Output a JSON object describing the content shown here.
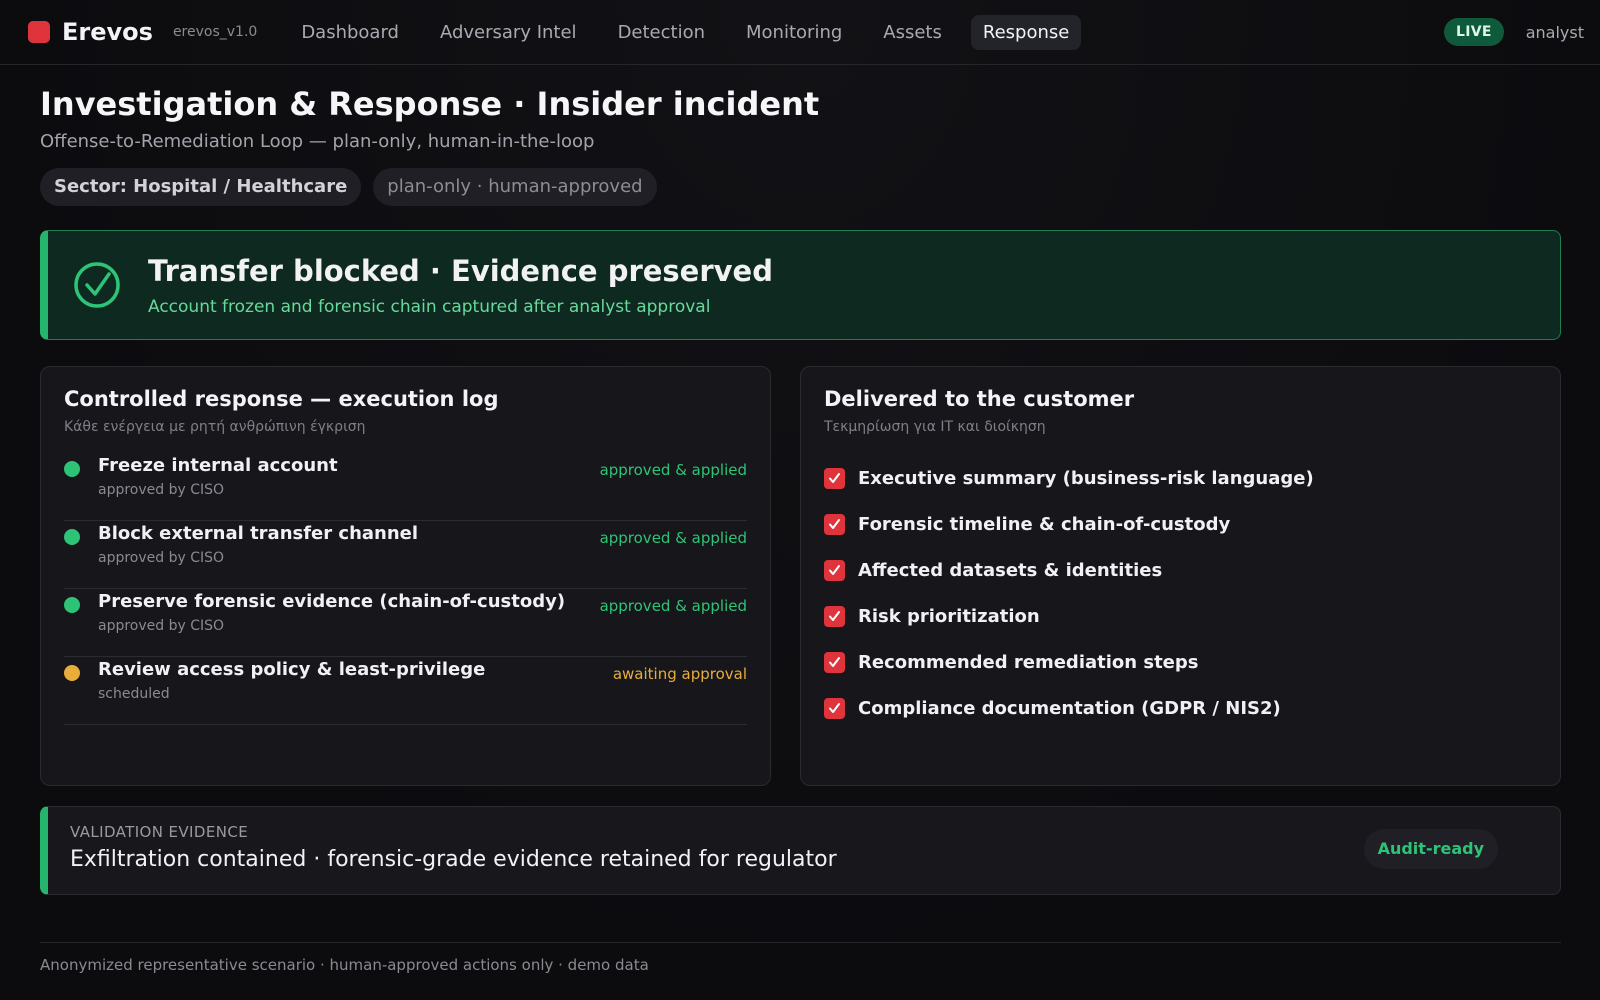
{
  "app": {
    "name": "Erevos",
    "version": "erevos_v1.0",
    "brand_color": "#e0343d"
  },
  "nav": {
    "items": [
      {
        "label": "Dashboard",
        "active": false
      },
      {
        "label": "Adversary Intel",
        "active": false
      },
      {
        "label": "Detection",
        "active": false
      },
      {
        "label": "Monitoring",
        "active": false
      },
      {
        "label": "Assets",
        "active": false
      },
      {
        "label": "Response",
        "active": true
      }
    ],
    "live_label": "LIVE",
    "user": "analyst"
  },
  "header": {
    "title": "Investigation & Response · Insider incident",
    "subtitle": "Offense-to-Remediation Loop — plan-only, human-in-the-loop",
    "chips": {
      "sector": "Sector: Hospital / Healthcare",
      "mode": "plan-only · human-approved"
    }
  },
  "banner": {
    "icon": "check-circle-icon",
    "title": "Transfer blocked · Evidence preserved",
    "subtitle": "Account frozen and forensic chain captured after analyst approval",
    "accent_color": "#25b56d"
  },
  "execution_log": {
    "title": "Controlled response — execution log",
    "subtitle": "Κάθε ενέργεια με ρητή ανθρώπινη έγκριση",
    "items": [
      {
        "action": "Freeze internal account",
        "detail": "approved by CISO",
        "status": "approved & applied",
        "state": "done"
      },
      {
        "action": "Block external transfer channel",
        "detail": "approved by CISO",
        "status": "approved & applied",
        "state": "done"
      },
      {
        "action": "Preserve forensic evidence (chain-of-custody)",
        "detail": "approved by CISO",
        "status": "approved & applied",
        "state": "done"
      },
      {
        "action": "Review access policy & least-privilege",
        "detail": "scheduled",
        "status": "awaiting approval",
        "state": "pending"
      }
    ],
    "status_colors": {
      "done": "#2ec477",
      "pending": "#e8ad3a"
    }
  },
  "deliverables": {
    "title": "Delivered to the customer",
    "subtitle": "Τεκμηρίωση για IT και διοίκηση",
    "items": [
      "Executive summary (business-risk language)",
      "Forensic timeline & chain-of-custody",
      "Affected datasets & identities",
      "Risk prioritization",
      "Recommended remediation steps",
      "Compliance documentation (GDPR / NIS2)"
    ]
  },
  "validation": {
    "kicker": "VALIDATION EVIDENCE",
    "text": "Exfiltration contained · forensic-grade evidence retained for regulator",
    "badge": "Audit-ready"
  },
  "footer": {
    "text": "Anonymized representative scenario · human-approved actions only · demo data"
  }
}
